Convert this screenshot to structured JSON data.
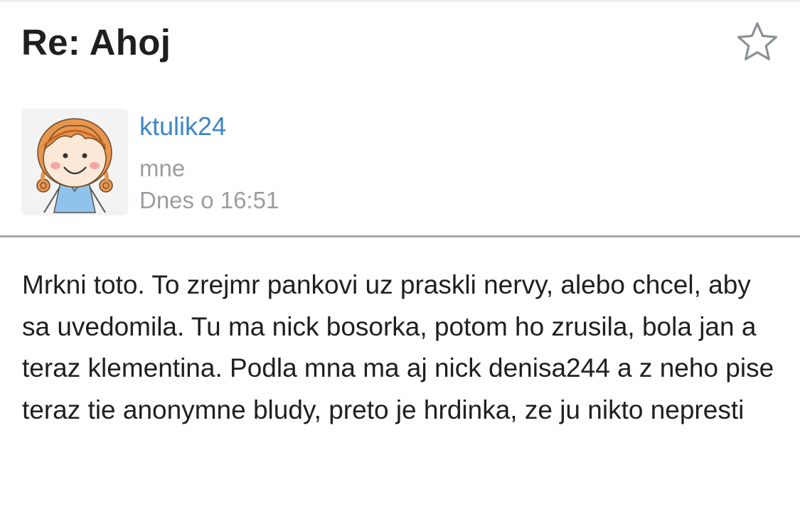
{
  "message": {
    "subject": "Re: Ahoj",
    "sender": "ktulik24",
    "recipient": "mne",
    "date": "Dnes o 16:51",
    "body": "Mrkni toto. To zrejmr pankovi uz praskli nervy, alebo chcel, aby sa uvedomila. Tu ma nick bosorka, potom ho zrusila, bola jan a teraz klementina. Podla mna ma aj nick denisa244 a z neho pise teraz tie anonymne bludy, preto je hrdinka, ze ju nikto nepresti"
  },
  "icons": {
    "star": "star-outline-icon",
    "avatar": "cartoon-girl-avatar"
  },
  "colors": {
    "sender_link": "#3d85c6",
    "meta_text": "#9a9ea3",
    "divider": "#a5a8ac",
    "text": "#1f1f1f"
  }
}
